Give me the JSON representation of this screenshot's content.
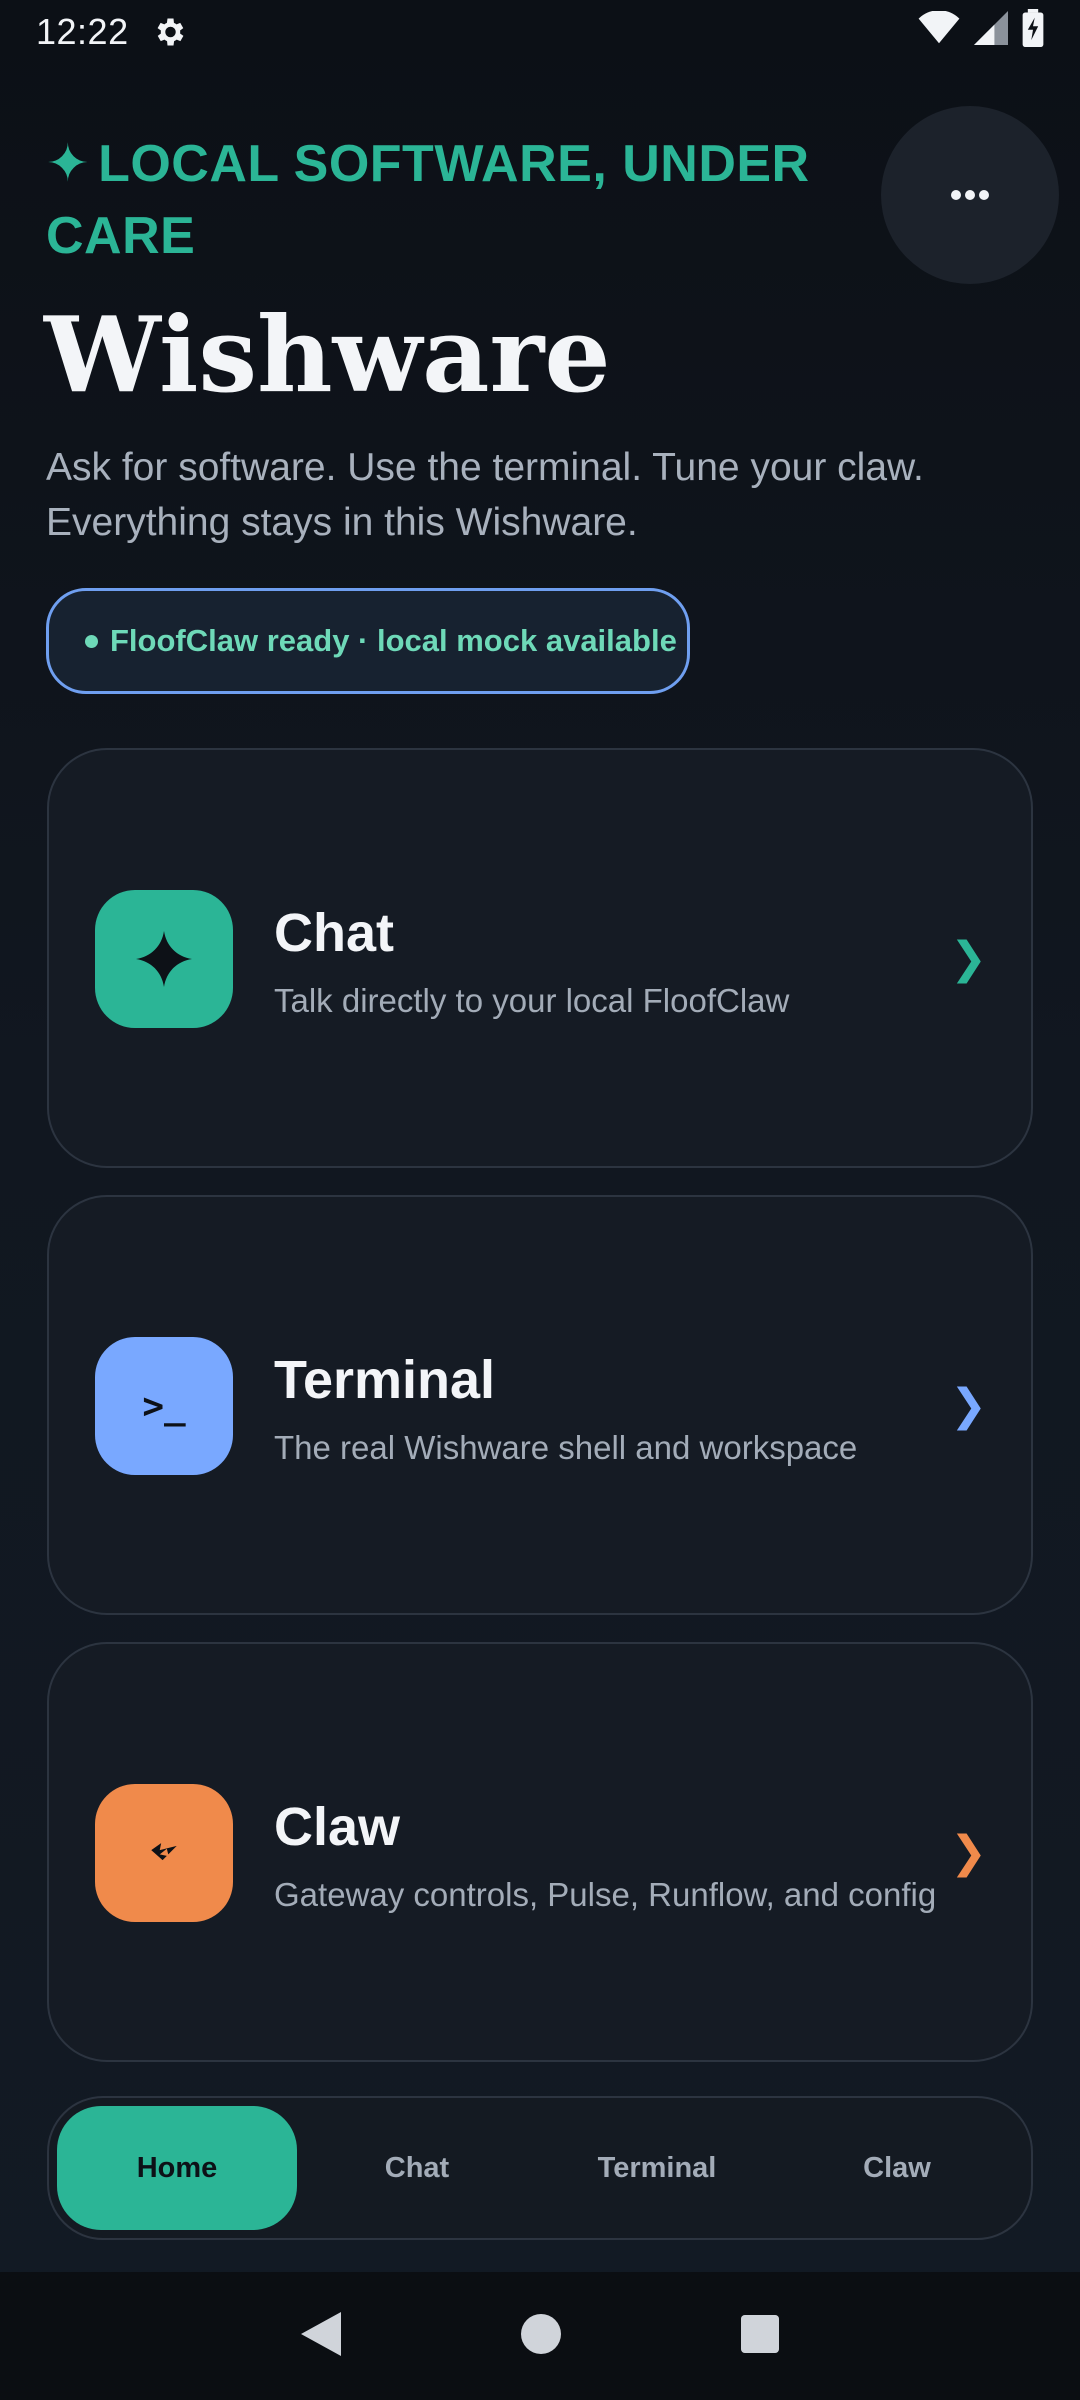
{
  "status_bar": {
    "time": "12:22"
  },
  "header": {
    "eyebrow": "LOCAL SOFTWARE, UNDER CARE",
    "title": "Wishware",
    "subtitle": "Ask for software. Use the terminal. Tune your claw. Everything stays in this Wishware.",
    "status_pill": "FloofClaw ready · local mock available"
  },
  "cards": [
    {
      "title": "Chat",
      "description": "Talk directly to your local FloofClaw",
      "icon": "sparkle-icon",
      "color": "#2bb596",
      "icon_glyph": "✦"
    },
    {
      "title": "Terminal",
      "description": "The real Wishware shell and workspace",
      "icon": "terminal-icon",
      "color": "#79a8ff",
      "icon_glyph": ">_"
    },
    {
      "title": "Claw",
      "description": "Gateway controls, Pulse, Runflow, and config",
      "icon": "bolt-icon",
      "color": "#f08a4b",
      "icon_glyph": "ϟ"
    }
  ],
  "bottom_nav": {
    "items": [
      {
        "label": "Home",
        "active": true
      },
      {
        "label": "Chat",
        "active": false
      },
      {
        "label": "Terminal",
        "active": false
      },
      {
        "label": "Claw",
        "active": false
      }
    ]
  },
  "colors": {
    "accent": "#2bb596",
    "terminal": "#79a8ff",
    "claw": "#f08a4b",
    "pill_text": "#6ed9b8"
  }
}
